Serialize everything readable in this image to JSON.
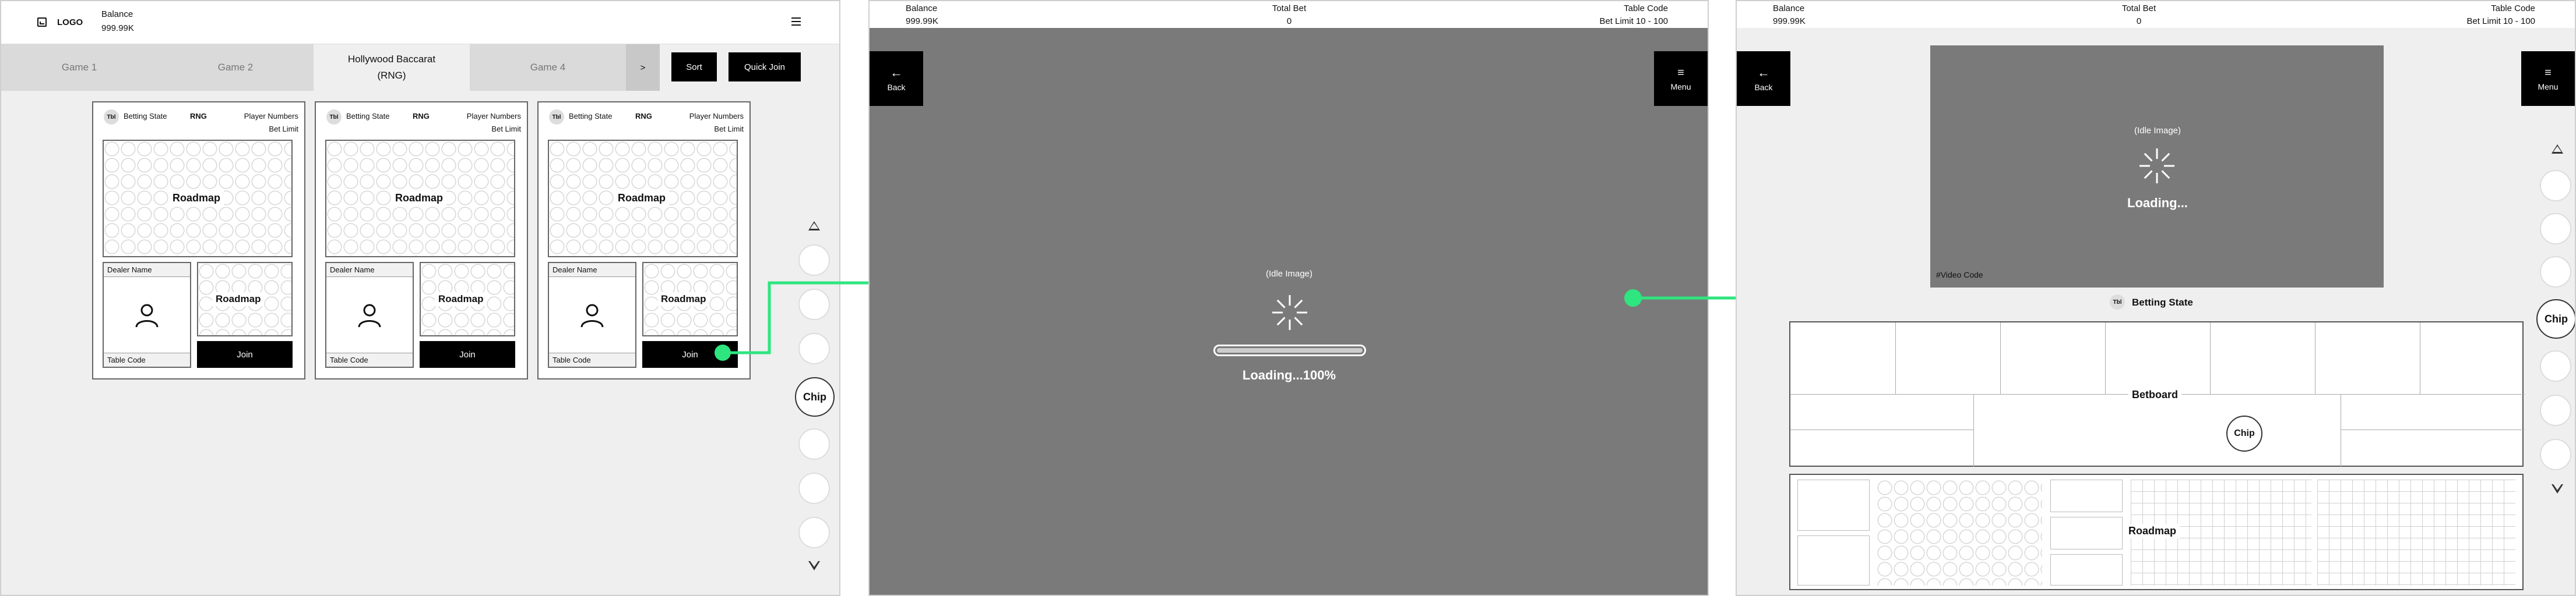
{
  "screen1": {
    "logo": "LOGO",
    "balance_label": "Balance",
    "balance_value": "999.99K",
    "tabs": [
      "Game 1",
      "Game 2",
      "Hollywood Baccarat\n(RNG)",
      "Game 4",
      ">"
    ],
    "sort_label": "Sort",
    "quick_join_label": "Quick Join",
    "card": {
      "badge": "Tbl",
      "betting_state": "Betting State",
      "rng": "RNG",
      "player_numbers": "Player Numbers",
      "bet_limit": "Bet Limit",
      "roadmap": "Roadmap",
      "dealer_name": "Dealer Name",
      "table_code": "Table Code",
      "join": "Join"
    },
    "chip_label": "Chip"
  },
  "screen2": {
    "balance_label": "Balance",
    "balance_value": "999.99K",
    "total_bet_label": "Total Bet",
    "total_bet_value": "0",
    "table_code_label": "Table Code",
    "bet_limit_text": "Bet Limit 10 - 100",
    "back_label": "Back",
    "menu_label": "Menu",
    "idle_image": "(Idle Image)",
    "loading_text": "Loading...100%",
    "progress": 1.0
  },
  "screen3": {
    "balance_label": "Balance",
    "balance_value": "999.99K",
    "total_bet_label": "Total Bet",
    "total_bet_value": "0",
    "table_code_label": "Table Code",
    "bet_limit_text": "Bet Limit 10 - 100",
    "back_label": "Back",
    "menu_label": "Menu",
    "idle_image": "(Idle Image)",
    "loading_text": "Loading...",
    "video_code": "#Video Code",
    "badge": "Tbl",
    "betting_state": "Betting State",
    "betboard": "Betboard",
    "chip_label": "Chip",
    "roadmap": "Roadmap"
  },
  "colors": {
    "accent": "#2ee57f",
    "dark": "#000000",
    "video_bg": "#7a7a7a"
  }
}
